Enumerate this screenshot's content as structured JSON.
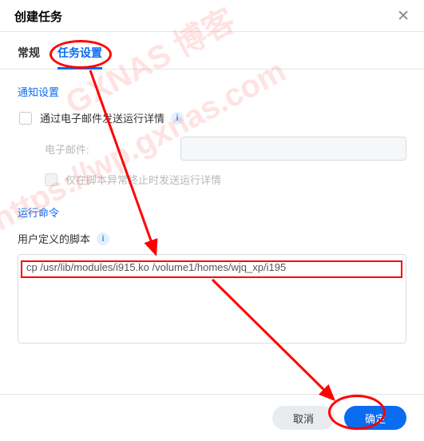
{
  "header": {
    "title": "创建任务"
  },
  "tabs": [
    {
      "label": "常规",
      "active": false
    },
    {
      "label": "任务设置",
      "active": true
    }
  ],
  "notification": {
    "section_title": "通知设置",
    "email_checkbox_label": "通过电子邮件发送运行详情",
    "email_field_label": "电子邮件:",
    "email_value": "",
    "only_on_error_label": "仅在脚本异常终止时发送运行详情"
  },
  "script": {
    "section_title": "运行命令",
    "field_label": "用户定义的脚本",
    "value": "cp /usr/lib/modules/i915.ko /volume1/homes/wjq_xp/i195"
  },
  "footer": {
    "cancel": "取消",
    "ok": "确定"
  },
  "watermark": {
    "line1": "GXNAS 博客",
    "line2": "https://wp.gxnas.com"
  }
}
